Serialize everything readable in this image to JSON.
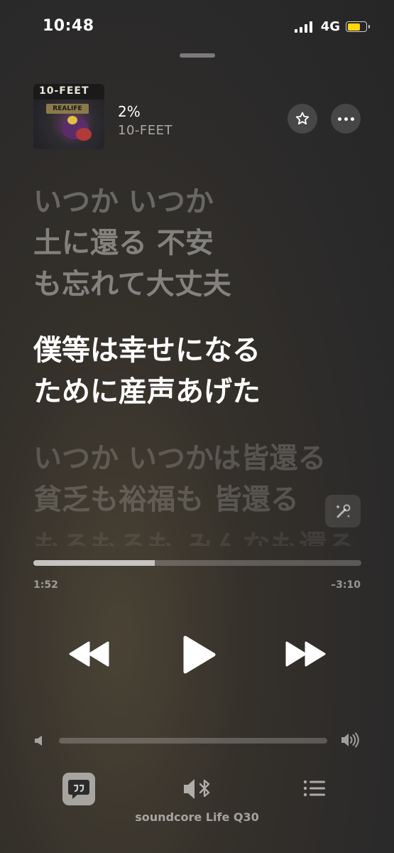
{
  "status_bar": {
    "time": "10:48",
    "network": "4G",
    "battery_level": 0.7
  },
  "now_playing": {
    "title": "2%",
    "artist": "10-FEET",
    "artwork": {
      "logo_text": "10-FEET",
      "sub_text": "REALIFE"
    }
  },
  "lyrics": {
    "previous": [
      "いつか いつか",
      "土に還る 不安",
      "も忘れて大丈夫"
    ],
    "current": [
      "僕等は幸せになる",
      "ために産声あげた"
    ],
    "next": [
      "いつか いつかは皆還る",
      "貧乏も裕福も 皆還る"
    ],
    "upcoming_partial": "もろもろも みんなも還る"
  },
  "progress": {
    "elapsed": "1:52",
    "remaining": "–3:10",
    "fraction": 0.37
  },
  "volume": {
    "level": 0.0
  },
  "bottom_bar": {
    "output_device": "soundcore Life Q30"
  },
  "icons": {
    "favorite": "star-icon",
    "more": "ellipsis-icon",
    "lyrics_magic": "microphone-sparkle-icon",
    "rewind": "backward-icon",
    "play": "play-icon",
    "forward": "forward-icon",
    "vol_low": "speaker-low-icon",
    "vol_high": "speaker-high-icon",
    "lyrics_tab": "quote-bubble-icon",
    "output": "speaker-bluetooth-icon",
    "queue": "list-icon"
  },
  "colors": {
    "battery": "#ffd60a",
    "background": "#2b2a2a"
  }
}
